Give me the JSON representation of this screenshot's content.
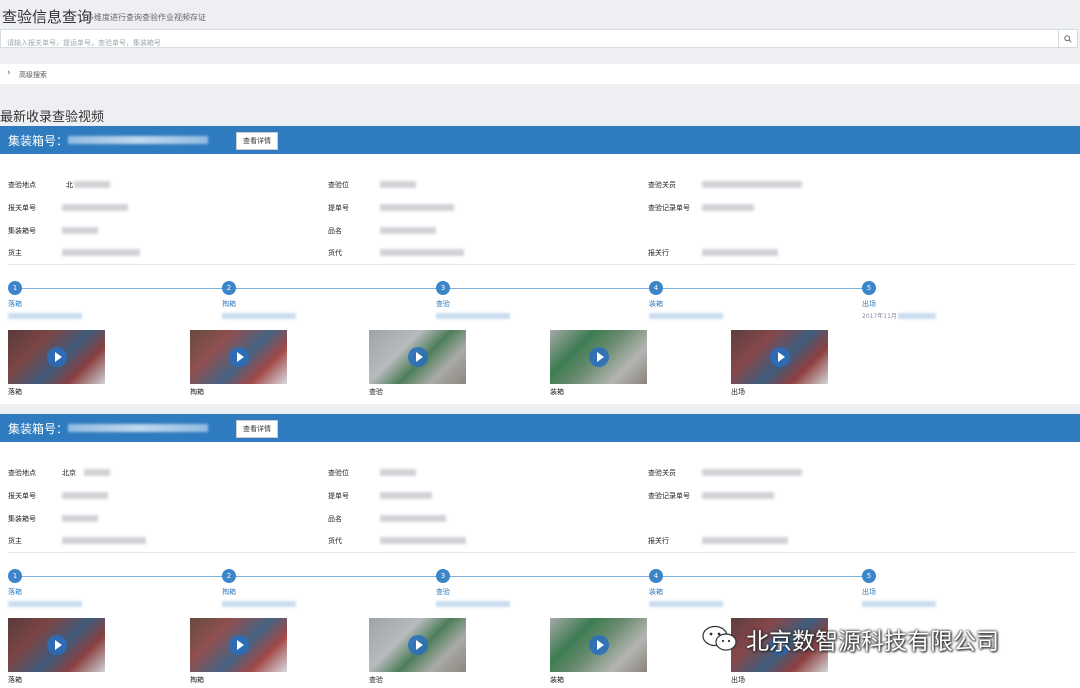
{
  "page": {
    "title": "查验信息查询",
    "subtitle": "多维度进行查询查验作业视频存证",
    "search_placeholder": "请输入报关单号，提运单号，查验单号，集装箱号",
    "advanced_label": "高级搜索",
    "section_title": "最新收录查验视频"
  },
  "card_common": {
    "header_label": "集装箱号：",
    "detail_button": "查看详情",
    "fields": [
      "查验地点",
      "查验位",
      "查验关员",
      "报关单号",
      "提单号",
      "查验记录单号",
      "集装箱号",
      "品名",
      "货主",
      "货代",
      "报关行"
    ],
    "steps": [
      {
        "num": "1",
        "name": "落箱"
      },
      {
        "num": "2",
        "name": "掏箱"
      },
      {
        "num": "3",
        "name": "查验"
      },
      {
        "num": "4",
        "name": "装箱"
      },
      {
        "num": "5",
        "name": "出场"
      }
    ]
  },
  "cards": [
    {
      "values": {
        "查验地点": "北",
        "品名": "",
        "step5_time": "2017年11月"
      },
      "thumbs": [
        "落箱",
        "掏箱",
        "查验",
        "装箱",
        "出场"
      ]
    },
    {
      "values": {
        "查验地点": "北京"
      },
      "thumbs": [
        "落箱",
        "掏箱",
        "查验",
        "装箱",
        "出场"
      ]
    }
  ],
  "watermark": {
    "text": "北京数智源科技有限公司",
    "icon": "wechat-icon"
  },
  "colors": {
    "accent": "#2e7bbf",
    "timeline": "#7fb0db",
    "background": "#eeeff2"
  }
}
